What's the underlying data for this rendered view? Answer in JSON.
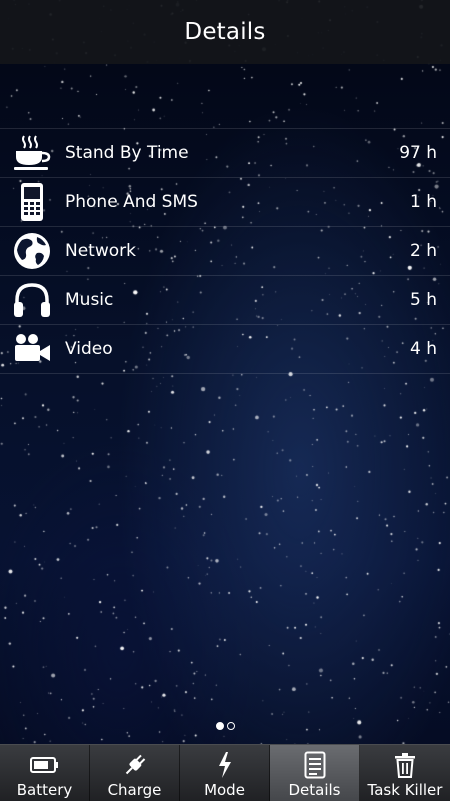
{
  "header": {
    "title": "Details"
  },
  "rows": [
    {
      "icon": "coffee-cup-icon",
      "label": "Stand By Time",
      "value": "97 h"
    },
    {
      "icon": "phone-icon",
      "label": "Phone And SMS",
      "value": "1 h"
    },
    {
      "icon": "globe-icon",
      "label": "Network",
      "value": "2 h"
    },
    {
      "icon": "headphones-icon",
      "label": "Music",
      "value": "5 h"
    },
    {
      "icon": "video-camera-icon",
      "label": "Video",
      "value": "4 h"
    }
  ],
  "pager": {
    "pages": 2,
    "current": 1
  },
  "tabs": [
    {
      "icon": "battery-icon",
      "label": "Battery"
    },
    {
      "icon": "plug-icon",
      "label": "Charge"
    },
    {
      "icon": "lightning-icon",
      "label": "Mode"
    },
    {
      "icon": "document-icon",
      "label": "Details",
      "selected": true
    },
    {
      "icon": "trash-icon",
      "label": "Task Killer"
    }
  ]
}
